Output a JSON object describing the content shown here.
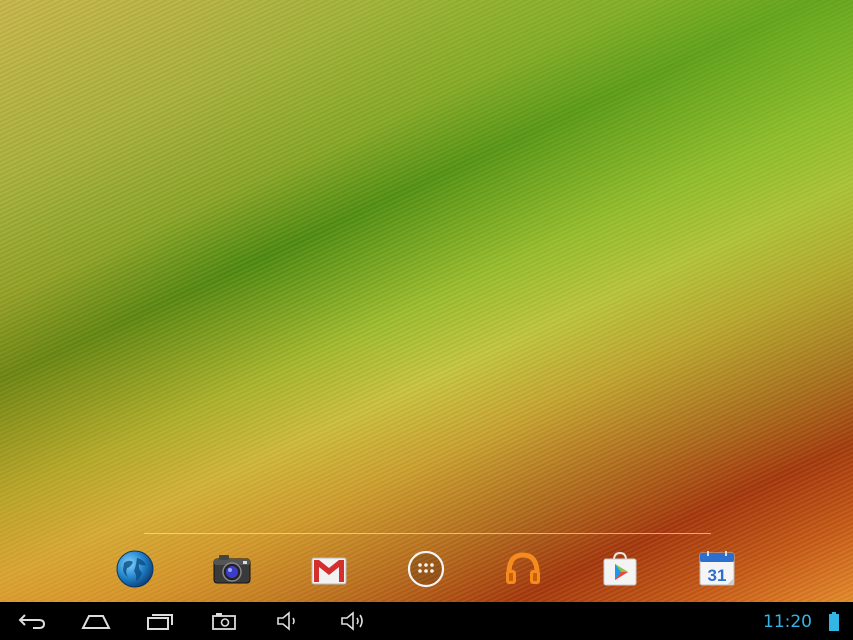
{
  "status_bar": {
    "clock": "11:20",
    "accent_color": "#33b5e5"
  },
  "dock": {
    "apps": [
      {
        "name": "browser",
        "icon": "globe-icon"
      },
      {
        "name": "camera",
        "icon": "camera-icon"
      },
      {
        "name": "gmail",
        "icon": "gmail-icon"
      },
      {
        "name": "all-apps",
        "icon": "app-drawer-icon"
      },
      {
        "name": "play-music",
        "icon": "headphones-icon"
      },
      {
        "name": "play-store",
        "icon": "play-store-icon"
      },
      {
        "name": "calendar",
        "icon": "calendar-icon",
        "label": "31"
      }
    ]
  },
  "navigation": {
    "buttons": [
      "back-icon",
      "home-icon",
      "recent-apps-icon",
      "screenshot-icon",
      "volume-down-icon",
      "volume-up-icon"
    ]
  }
}
